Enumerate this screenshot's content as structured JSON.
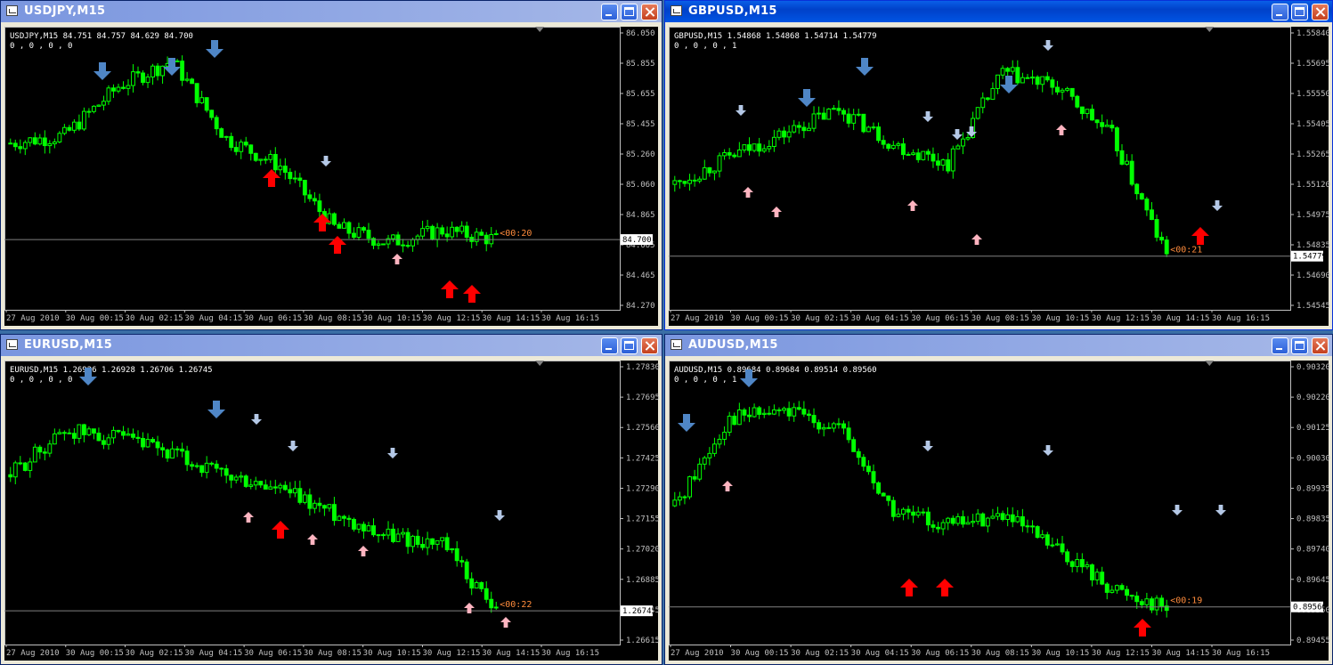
{
  "windows": [
    {
      "id": "usdjpy",
      "title": "USDJPY,M15",
      "active": false,
      "info": "USDJPY,M15  84.751 84.757 84.629 84.700",
      "indicator": "0 , 0 , 0 , 0",
      "price_labels": [
        "86.050",
        "85.855",
        "85.655",
        "85.455",
        "85.260",
        "85.060",
        "84.865",
        "84.665",
        "84.465",
        "84.270"
      ],
      "current_price": "84.700",
      "countdown": "<00:20",
      "time_labels": [
        "27 Aug 2010",
        "30 Aug 00:15",
        "30 Aug 02:15",
        "30 Aug 04:15",
        "30 Aug 06:15",
        "30 Aug 08:15",
        "30 Aug 10:15",
        "30 Aug 12:15",
        "30 Aug 14:15",
        "30 Aug 16:15"
      ]
    },
    {
      "id": "gbpusd",
      "title": "GBPUSD,M15",
      "active": true,
      "info": "GBPUSD,M15  1.54868 1.54868 1.54714 1.54779",
      "indicator": "0 , 0 , 0 , 1",
      "price_labels": [
        "1.55840",
        "1.55695",
        "1.55550",
        "1.55405",
        "1.55265",
        "1.55120",
        "1.54975",
        "1.54835",
        "1.54690",
        "1.54545"
      ],
      "current_price": "1.54779",
      "countdown": "<00:21",
      "time_labels": [
        "27 Aug 2010",
        "30 Aug 00:15",
        "30 Aug 02:15",
        "30 Aug 04:15",
        "30 Aug 06:15",
        "30 Aug 08:15",
        "30 Aug 10:15",
        "30 Aug 12:15",
        "30 Aug 14:15",
        "30 Aug 16:15"
      ]
    },
    {
      "id": "eurusd",
      "title": "EURUSD,M15",
      "active": false,
      "info": "EURUSD,M15  1.26926 1.26928 1.26706 1.26745",
      "indicator": "0 , 0 , 0 , 0",
      "price_labels": [
        "1.27830",
        "1.27695",
        "1.27560",
        "1.27425",
        "1.27290",
        "1.27155",
        "1.27020",
        "1.26885",
        "1.26745",
        "1.26615"
      ],
      "current_price": "1.26745",
      "countdown": "<00:22",
      "time_labels": [
        "27 Aug 2010",
        "30 Aug 00:15",
        "30 Aug 02:15",
        "30 Aug 04:15",
        "30 Aug 06:15",
        "30 Aug 08:15",
        "30 Aug 10:15",
        "30 Aug 12:15",
        "30 Aug 14:15",
        "30 Aug 16:15"
      ]
    },
    {
      "id": "audusd",
      "title": "AUDUSD,M15",
      "active": false,
      "info": "AUDUSD,M15  0.89684 0.89684 0.89514 0.89560",
      "indicator": "0 , 0 , 0 , 1",
      "price_labels": [
        "0.90320",
        "0.90220",
        "0.90125",
        "0.90030",
        "0.89935",
        "0.89835",
        "0.89740",
        "0.89645",
        "0.89550",
        "0.89455"
      ],
      "current_price": "0.89560",
      "countdown": "<00:19",
      "time_labels": [
        "27 Aug 2010",
        "30 Aug 00:15",
        "30 Aug 02:15",
        "30 Aug 04:15",
        "30 Aug 06:15",
        "30 Aug 08:15",
        "30 Aug 10:15",
        "30 Aug 12:15",
        "30 Aug 14:15",
        "30 Aug 16:15"
      ]
    }
  ],
  "chart_data": [
    {
      "type": "candlestick",
      "symbol": "USDJPY",
      "ylim": [
        84.27,
        86.05
      ],
      "x": [
        "27 Aug 2010",
        "30 Aug 00:15",
        "30 Aug 02:15",
        "30 Aug 04:15",
        "30 Aug 06:15",
        "30 Aug 08:15",
        "30 Aug 10:15",
        "30 Aug 12:15",
        "30 Aug 14:15",
        "30 Aug 16:15"
      ],
      "close": [
        85.33,
        85.38,
        85.7,
        85.87,
        85.36,
        85.18,
        84.78,
        84.68,
        84.76,
        84.7
      ]
    },
    {
      "type": "candlestick",
      "symbol": "GBPUSD",
      "ylim": [
        1.54545,
        1.5584
      ],
      "x": [
        "27 Aug 2010",
        "30 Aug 00:15",
        "30 Aug 02:15",
        "30 Aug 04:15",
        "30 Aug 06:15",
        "30 Aug 08:15",
        "30 Aug 10:15",
        "30 Aug 12:15",
        "30 Aug 14:15",
        "30 Aug 16:15"
      ],
      "close": [
        1.5512,
        1.5525,
        1.5536,
        1.5548,
        1.5531,
        1.5522,
        1.5565,
        1.5558,
        1.5535,
        1.54779
      ]
    },
    {
      "type": "candlestick",
      "symbol": "EURUSD",
      "ylim": [
        1.26615,
        1.2783
      ],
      "x": [
        "27 Aug 2010",
        "30 Aug 00:15",
        "30 Aug 02:15",
        "30 Aug 04:15",
        "30 Aug 06:15",
        "30 Aug 08:15",
        "30 Aug 10:15",
        "30 Aug 12:15",
        "30 Aug 14:15",
        "30 Aug 16:15"
      ],
      "close": [
        1.2735,
        1.2755,
        1.2751,
        1.2744,
        1.2734,
        1.2728,
        1.2718,
        1.2708,
        1.2704,
        1.26745
      ]
    },
    {
      "type": "candlestick",
      "symbol": "AUDUSD",
      "ylim": [
        0.89455,
        0.9032
      ],
      "x": [
        "27 Aug 2010",
        "30 Aug 00:15",
        "30 Aug 02:15",
        "30 Aug 04:15",
        "30 Aug 06:15",
        "30 Aug 08:15",
        "30 Aug 10:15",
        "30 Aug 12:15",
        "30 Aug 14:15",
        "30 Aug 16:15"
      ],
      "close": [
        0.8988,
        0.9016,
        0.9018,
        0.9013,
        0.8986,
        0.8982,
        0.8985,
        0.8974,
        0.8962,
        0.8956
      ]
    }
  ],
  "colors": {
    "background": "#000000",
    "candle": "#00ff00",
    "text": "#ffffff",
    "axis": "#c0c0c0",
    "countdown": "#ff8c3c",
    "arrow_strong_down": "#4f86c6",
    "arrow_weak_down": "#b4c8e6",
    "arrow_strong_up": "#ff0000",
    "arrow_weak_up": "#ffb4c0"
  },
  "icons": [
    "app-icon",
    "minimize-icon",
    "maximize-icon",
    "close-icon",
    "arrow-up-icon",
    "arrow-down-icon"
  ]
}
